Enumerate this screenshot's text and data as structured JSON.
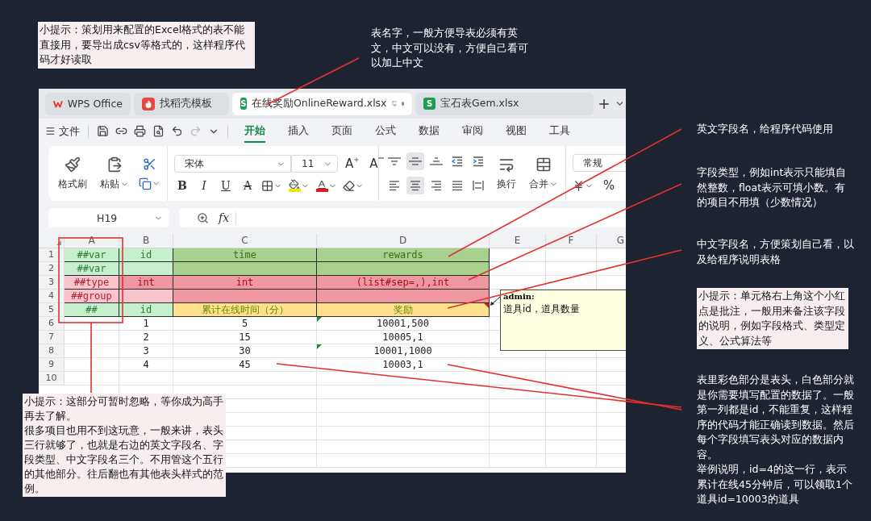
{
  "top_tip": "小提示：策划用来配置的Excel格式的表不能直接用，要导出成csv等格式的，这样程序代码才好读取",
  "sheet_name_note": "表名字，一般方便导表必须有英文，中文可以没有，方便自己看可以加上中文",
  "tabs": [
    {
      "kind": "wps",
      "label": "WPS Office",
      "selected": false
    },
    {
      "kind": "docer",
      "label": "找稻壳模板",
      "selected": false
    },
    {
      "kind": "sheet",
      "badge": "S",
      "label": "在线奖励OnlineReward.xlsx",
      "selected": true
    },
    {
      "kind": "sheet",
      "badge": "S",
      "label": "宝石表Gem.xlsx",
      "selected": false
    }
  ],
  "menu": {
    "file": "文件",
    "tabs": [
      {
        "label": "开始",
        "selected": true
      },
      {
        "label": "插入",
        "selected": false
      },
      {
        "label": "页面",
        "selected": false
      },
      {
        "label": "公式",
        "selected": false
      },
      {
        "label": "数据",
        "selected": false
      },
      {
        "label": "审阅",
        "selected": false
      },
      {
        "label": "视图",
        "selected": false
      },
      {
        "label": "工具",
        "selected": false
      }
    ]
  },
  "ribbon": {
    "format_painter": "格式刷",
    "paste": "粘贴",
    "font": "宋体",
    "size": "11",
    "grow": "A",
    "shrink": "A",
    "styles": [
      {
        "kind": "bold",
        "label": "B"
      },
      {
        "kind": "italic",
        "label": "I"
      },
      {
        "kind": "underline",
        "label": "U"
      },
      {
        "kind": "strike",
        "label": "A"
      }
    ],
    "vertical_align": [
      {
        "kind": "top",
        "selected": false
      },
      {
        "kind": "middle",
        "selected": true
      },
      {
        "kind": "bottom",
        "selected": false
      }
    ],
    "horizontal_align": [
      {
        "kind": "left",
        "selected": false
      },
      {
        "kind": "center",
        "selected": true
      },
      {
        "kind": "right",
        "selected": false
      },
      {
        "kind": "justify",
        "selected": false
      },
      {
        "kind": "distributed",
        "selected": false
      }
    ],
    "wrap": "换行",
    "merge": "合并",
    "number_format": "常规",
    "percent": "%"
  },
  "formula_bar": {
    "cell": "H19",
    "fx": "fx"
  },
  "sheet": {
    "columns": [
      "A",
      "B",
      "C",
      "D",
      "E",
      "F",
      "G"
    ],
    "rows": [
      {
        "number": "1",
        "cells": [
          {
            "kind": "light_green",
            "text": "##var"
          },
          {
            "kind": "light_green",
            "text": "id"
          },
          {
            "kind": "green",
            "text": "time"
          },
          {
            "kind": "green",
            "text": "rewards"
          }
        ]
      },
      {
        "number": "2",
        "cells": [
          {
            "kind": "light_green",
            "text": "##var"
          },
          {
            "kind": "light_green"
          },
          {
            "kind": "green"
          },
          {
            "kind": "green"
          }
        ]
      },
      {
        "number": "3",
        "cells": [
          {
            "kind": "light_red",
            "text": "##type"
          },
          {
            "kind": "red",
            "text": "int"
          },
          {
            "kind": "red",
            "text": "int"
          },
          {
            "kind": "red",
            "text": "(list#sep=,),int"
          }
        ]
      },
      {
        "number": "4",
        "cells": [
          {
            "kind": "light_red",
            "text": "##group"
          },
          {
            "kind": "light_red"
          },
          {
            "kind": "red"
          },
          {
            "kind": "red"
          }
        ]
      },
      {
        "number": "5",
        "cells": [
          {
            "kind": "light_green",
            "text": "##"
          },
          {
            "kind": "light_green",
            "text": "id"
          },
          {
            "kind": "yellow",
            "text": "累计在线时间（分）"
          },
          {
            "kind": "yellow",
            "text": "奖励",
            "comment": true
          }
        ]
      },
      {
        "number": "6",
        "cells": [
          {
            "kind": "data"
          },
          {
            "kind": "data",
            "text": "1"
          },
          {
            "kind": "data",
            "text": "5"
          },
          {
            "kind": "data",
            "text": "10001,500",
            "flag": true
          }
        ]
      },
      {
        "number": "7",
        "cells": [
          {
            "kind": "data"
          },
          {
            "kind": "data",
            "text": "2"
          },
          {
            "kind": "data",
            "text": "15"
          },
          {
            "kind": "data",
            "text": "10005,1",
            "flag": false
          }
        ]
      },
      {
        "number": "8",
        "cells": [
          {
            "kind": "data"
          },
          {
            "kind": "data",
            "text": "3"
          },
          {
            "kind": "data",
            "text": "30"
          },
          {
            "kind": "data",
            "text": "10001,1000",
            "flag": true
          }
        ]
      },
      {
        "number": "9",
        "cells": [
          {
            "kind": "data"
          },
          {
            "kind": "data",
            "text": "4"
          },
          {
            "kind": "data",
            "text": "45"
          },
          {
            "kind": "data",
            "text": "10003,1",
            "flag": false
          }
        ]
      },
      {
        "number": "10",
        "cells": []
      }
    ]
  },
  "comment": {
    "author": "admin:",
    "text": "道具id，道具数量"
  },
  "field_notes": [
    "英文字段名，给程序代码使用",
    "字段类型，例如int表示只能填自然整数，float表示可填小数。有的项目不用填（少数情况）",
    "中文字段名，方便策划自己看，以及给程序说明表格"
  ],
  "comment_tip": "小提示：单元格右上角这个小红点是批注，一般用来备注该字段的说明，例如字段格式、类型定义、公式算法等",
  "data_note": [
    "表里彩色部分是表头，白色部分就是你需要填写配置的数据了。一般第一列都是id，不能重复，这样程序的代码才能正确读到数据。然后每个字段填写表头对应的数据内容。",
    "举例说明，id=4的这一行，表示累计在线45分钟后，可以领取1个道具id=10003的道具"
  ],
  "header_tip": [
    "小提示：这部分可暂时忽略，等你成为高手再去了解。",
    "很多项目也用不到这玩意，一般来讲，表头三行就够了，也就是右边的英文字段名、字段类型、中文字段名三个。不用管这个五行的其他部分。往后翻也有其他表头样式的范例。"
  ]
}
